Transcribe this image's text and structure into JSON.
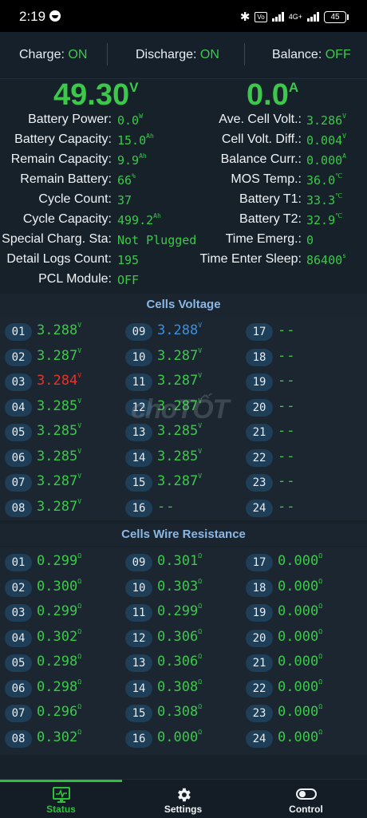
{
  "status_bar": {
    "time": "2:19",
    "network": "4G+",
    "battery": "45"
  },
  "switches": [
    {
      "label": "Charge: ",
      "state": "ON"
    },
    {
      "label": "Discharge: ",
      "state": "ON"
    },
    {
      "label": "Balance: ",
      "state": "OFF"
    }
  ],
  "voltage": {
    "value": "49.30",
    "unit": "V"
  },
  "current": {
    "value": "0.0",
    "unit": "A"
  },
  "left_info": [
    {
      "label": "Battery Power:",
      "value": "0.0",
      "unit": "W"
    },
    {
      "label": "Battery Capacity:",
      "value": "15.0",
      "unit": "Ah"
    },
    {
      "label": "Remain Capacity:",
      "value": "9.9",
      "unit": "Ah"
    },
    {
      "label": "Remain Battery:",
      "value": "66",
      "unit": "%"
    },
    {
      "label": "Cycle Count:",
      "value": "37",
      "unit": ""
    },
    {
      "label": "Cycle Capacity:",
      "value": "499.2",
      "unit": "Ah"
    },
    {
      "label": "Special Charg. Sta:",
      "value": "Not Plugged",
      "unit": ""
    },
    {
      "label": "Detail Logs Count:",
      "value": "195",
      "unit": ""
    },
    {
      "label": "PCL Module:",
      "value": "OFF",
      "unit": ""
    }
  ],
  "right_info": [
    {
      "label": "Ave. Cell Volt.:",
      "value": "3.286",
      "unit": "V"
    },
    {
      "label": "Cell Volt. Diff.:",
      "value": "0.004",
      "unit": "V"
    },
    {
      "label": "Balance Curr.:",
      "value": "0.000",
      "unit": "A"
    },
    {
      "label": "MOS Temp.:",
      "value": "36.0",
      "unit": "℃"
    },
    {
      "label": "Battery T1:",
      "value": "33.3",
      "unit": "℃"
    },
    {
      "label": "Battery T2:",
      "value": "32.9",
      "unit": "℃"
    },
    {
      "label": "Time Emerg.:",
      "value": "0",
      "unit": ""
    },
    {
      "label": "Time Enter Sleep:",
      "value": "86400",
      "unit": "s"
    }
  ],
  "cells_voltage": {
    "title": "Cells Voltage",
    "unit": "V",
    "cells": [
      {
        "id": "01",
        "value": "3.288"
      },
      {
        "id": "02",
        "value": "3.287"
      },
      {
        "id": "03",
        "value": "3.284",
        "status": "low"
      },
      {
        "id": "04",
        "value": "3.285"
      },
      {
        "id": "05",
        "value": "3.285"
      },
      {
        "id": "06",
        "value": "3.285"
      },
      {
        "id": "07",
        "value": "3.287"
      },
      {
        "id": "08",
        "value": "3.287"
      },
      {
        "id": "09",
        "value": "3.288",
        "status": "high"
      },
      {
        "id": "10",
        "value": "3.287"
      },
      {
        "id": "11",
        "value": "3.287"
      },
      {
        "id": "12",
        "value": "3.287"
      },
      {
        "id": "13",
        "value": "3.285"
      },
      {
        "id": "14",
        "value": "3.285"
      },
      {
        "id": "15",
        "value": "3.287"
      },
      {
        "id": "16",
        "value": "--"
      },
      {
        "id": "17",
        "value": "--"
      },
      {
        "id": "18",
        "value": "--"
      },
      {
        "id": "19",
        "value": "--"
      },
      {
        "id": "20",
        "value": "--"
      },
      {
        "id": "21",
        "value": "--"
      },
      {
        "id": "22",
        "value": "--"
      },
      {
        "id": "23",
        "value": "--"
      },
      {
        "id": "24",
        "value": "--"
      }
    ]
  },
  "cells_resistance": {
    "title": "Cells Wire Resistance",
    "unit": "Ω",
    "cells": [
      {
        "id": "01",
        "value": "0.299"
      },
      {
        "id": "02",
        "value": "0.300"
      },
      {
        "id": "03",
        "value": "0.299"
      },
      {
        "id": "04",
        "value": "0.302"
      },
      {
        "id": "05",
        "value": "0.298"
      },
      {
        "id": "06",
        "value": "0.298"
      },
      {
        "id": "07",
        "value": "0.296"
      },
      {
        "id": "08",
        "value": "0.302"
      },
      {
        "id": "09",
        "value": "0.301"
      },
      {
        "id": "10",
        "value": "0.303"
      },
      {
        "id": "11",
        "value": "0.299"
      },
      {
        "id": "12",
        "value": "0.306"
      },
      {
        "id": "13",
        "value": "0.306"
      },
      {
        "id": "14",
        "value": "0.308"
      },
      {
        "id": "15",
        "value": "0.308"
      },
      {
        "id": "16",
        "value": "0.000"
      },
      {
        "id": "17",
        "value": "0.000"
      },
      {
        "id": "18",
        "value": "0.000"
      },
      {
        "id": "19",
        "value": "0.000"
      },
      {
        "id": "20",
        "value": "0.000"
      },
      {
        "id": "21",
        "value": "0.000"
      },
      {
        "id": "22",
        "value": "0.000"
      },
      {
        "id": "23",
        "value": "0.000"
      },
      {
        "id": "24",
        "value": "0.000"
      }
    ]
  },
  "watermark": "choTỐT",
  "nav": [
    {
      "label": "Status",
      "icon": "monitor-heartbeat-icon",
      "active": true
    },
    {
      "label": "Settings",
      "icon": "gear-icon",
      "active": false
    },
    {
      "label": "Control",
      "icon": "toggle-icon",
      "active": false
    }
  ],
  "colors": {
    "accent_green": "#3cc84a",
    "low_cell": "#e8322a",
    "high_cell": "#3d8fe0",
    "section_title": "#8ab8e6",
    "background": "#17212a"
  }
}
